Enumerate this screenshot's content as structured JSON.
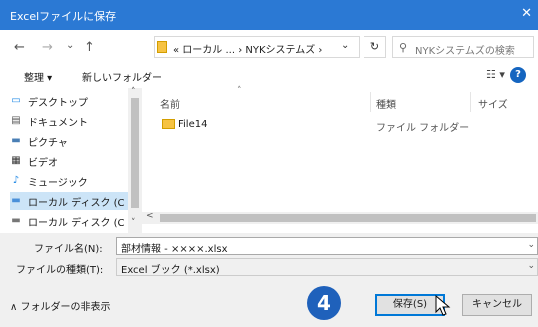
{
  "window": {
    "title": "Excelファイルに保存",
    "close_glyph": "✕"
  },
  "nav": {
    "back": "←",
    "forward": "→",
    "recent": "⌄",
    "up": "↑",
    "breadcrumb": "« ローカル ...  ›  NYKシステムズ  ›",
    "dropdown": "⌄",
    "refresh": "↻",
    "search_placeholder": "NYKシステムズの検索",
    "search_icon": "⚲"
  },
  "toolbar": {
    "organize": "整理 ▾",
    "new_folder": "新しいフォルダー",
    "view": "☷ ▾",
    "help": "?"
  },
  "sidebar": {
    "items": [
      {
        "label": "デスクトップ",
        "icon": "desktop-icon",
        "glyph": "▭"
      },
      {
        "label": "ドキュメント",
        "icon": "documents-icon",
        "glyph": "▤"
      },
      {
        "label": "ピクチャ",
        "icon": "pictures-icon",
        "glyph": "▬"
      },
      {
        "label": "ビデオ",
        "icon": "videos-icon",
        "glyph": "▦"
      },
      {
        "label": "ミュージック",
        "icon": "music-icon",
        "glyph": "♪"
      },
      {
        "label": "ローカル ディスク (C",
        "icon": "local-disk-icon",
        "glyph": "▬"
      },
      {
        "label": "ローカル ディスク (C",
        "icon": "local-disk-2-icon",
        "glyph": "▬"
      }
    ],
    "scroll_up": "˄",
    "scroll_down": "˅"
  },
  "file_list": {
    "headers": [
      "名前",
      "種類",
      "サイズ"
    ],
    "sort_glyph": "˄",
    "rows": [
      {
        "name": "File14",
        "type": "ファイル フォルダー"
      }
    ],
    "hscroll_left": "<"
  },
  "form": {
    "filename_label": "ファイル名(N):",
    "filename_value": "部材情報 - ××××.xlsx",
    "filetype_label": "ファイルの種類(T):",
    "filetype_value": "Excel ブック (*.xlsx)",
    "arrow": "⌄"
  },
  "footer": {
    "hide_folders": "∧  フォルダーの非表示",
    "step_badge": "4",
    "save": "保存(S)",
    "cancel": "キャンセル"
  },
  "colors": {
    "titlebar": "#2b79d4",
    "badge": "#1f61bb",
    "selected": "#cce4f7",
    "save_border": "#0078d7"
  }
}
